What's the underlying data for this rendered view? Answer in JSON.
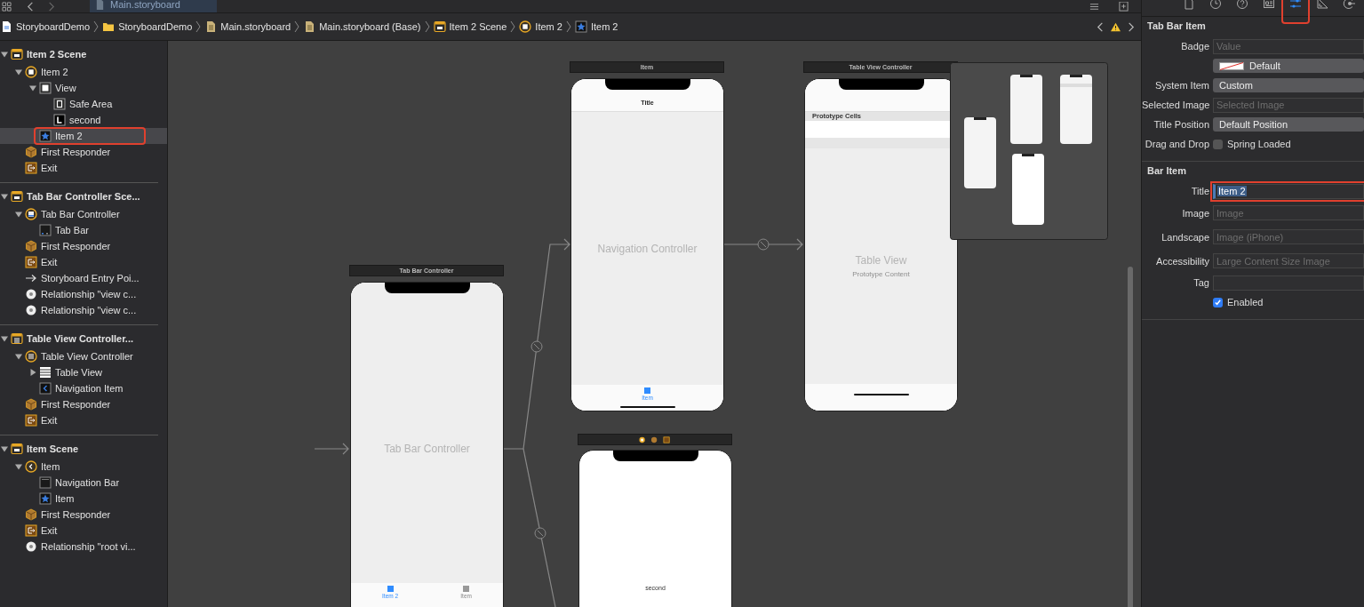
{
  "toolbar": {
    "tab": "Main.storyboard"
  },
  "jump_bar": [
    {
      "kind": "project",
      "text": "StoryboardDemo"
    },
    {
      "kind": "folder",
      "text": "StoryboardDemo"
    },
    {
      "kind": "storyboard",
      "text": "Main.storyboard"
    },
    {
      "kind": "storyboard",
      "text": "Main.storyboard (Base)"
    },
    {
      "kind": "scene",
      "text": "Item 2 Scene"
    },
    {
      "kind": "controller",
      "text": "Item 2"
    },
    {
      "kind": "star",
      "text": "Item 2"
    }
  ],
  "outline": [
    {
      "label": "Item 2 Scene",
      "kind": "scene",
      "expanded": true,
      "selected": false,
      "children": [
        {
          "label": "Item 2",
          "kind": "controller",
          "expanded": true,
          "selected": false,
          "children": [
            {
              "label": "View",
              "kind": "view",
              "expanded": true,
              "selected": false,
              "children": [
                {
                  "label": "Safe Area",
                  "kind": "safe-area",
                  "selected": false
                },
                {
                  "label": "second",
                  "kind": "label",
                  "selected": false
                }
              ]
            },
            {
              "label": "Item 2",
              "kind": "star",
              "selected": true
            }
          ]
        },
        {
          "label": "First Responder",
          "kind": "cube",
          "selected": false
        },
        {
          "label": "Exit",
          "kind": "exit",
          "selected": false
        }
      ]
    },
    {
      "label": "Tab Bar Controller Sce...",
      "kind": "scene",
      "expanded": true,
      "selected": false,
      "children": [
        {
          "label": "Tab Bar Controller",
          "kind": "tab-controller",
          "expanded": true,
          "selected": false,
          "children": [
            {
              "label": "Tab Bar",
              "kind": "tab-bar",
              "selected": false
            }
          ]
        },
        {
          "label": "First Responder",
          "kind": "cube",
          "selected": false
        },
        {
          "label": "Exit",
          "kind": "exit",
          "selected": false
        },
        {
          "label": "Storyboard Entry Poi...",
          "kind": "arrow",
          "selected": false
        },
        {
          "label": "Relationship \"view c...",
          "kind": "ring",
          "selected": false
        },
        {
          "label": "Relationship \"view c...",
          "kind": "ring",
          "selected": false
        }
      ]
    },
    {
      "label": "Table View Controller...",
      "kind": "scene-list",
      "expanded": true,
      "selected": false,
      "children": [
        {
          "label": "Table View Controller",
          "kind": "table-controller",
          "expanded": true,
          "selected": false,
          "children": [
            {
              "label": "Table View",
              "kind": "table",
              "expanded": false,
              "selected": false
            },
            {
              "label": "Navigation Item",
              "kind": "nav-item",
              "selected": false
            }
          ]
        },
        {
          "label": "First Responder",
          "kind": "cube",
          "selected": false
        },
        {
          "label": "Exit",
          "kind": "exit",
          "selected": false
        }
      ]
    },
    {
      "label": "Item Scene",
      "kind": "scene-tag",
      "expanded": true,
      "selected": false,
      "children": [
        {
          "label": "Item",
          "kind": "nav-controller",
          "expanded": true,
          "selected": false,
          "children": [
            {
              "label": "Navigation Bar",
              "kind": "nav-bar",
              "selected": false
            },
            {
              "label": "Item",
              "kind": "star",
              "selected": false
            }
          ]
        },
        {
          "label": "First Responder",
          "kind": "cube",
          "selected": false
        },
        {
          "label": "Exit",
          "kind": "exit",
          "selected": false
        },
        {
          "label": "Relationship \"root vi...",
          "kind": "ring",
          "selected": false
        }
      ]
    }
  ],
  "canvas": {
    "scenes": [
      {
        "kind": "tab-bar",
        "title": "Tab Bar Controller",
        "label": "Tab Bar Controller",
        "tab_items": [
          {
            "label": "Item 2",
            "selected": true
          },
          {
            "label": "Item",
            "selected": false
          }
        ]
      },
      {
        "kind": "navigation",
        "title": "Item",
        "nav_title": "Title",
        "label": "Navigation Controller",
        "tab_items": [
          {
            "label": "Item",
            "selected": true
          }
        ]
      },
      {
        "kind": "table",
        "title": "Table View Controller",
        "section_header": "Prototype Cells",
        "label": "Table View",
        "sublabel": "Prototype Content"
      },
      {
        "kind": "view",
        "label": "second"
      }
    ]
  },
  "inspector": {
    "tabs": [
      {
        "kind": "file",
        "selected": false
      },
      {
        "kind": "history",
        "selected": false
      },
      {
        "kind": "help",
        "selected": false
      },
      {
        "kind": "identity",
        "selected": false
      },
      {
        "kind": "attributes",
        "selected": true
      },
      {
        "kind": "size",
        "selected": false
      },
      {
        "kind": "connections",
        "selected": false
      }
    ],
    "sections": [
      {
        "title": "Tab Bar Item",
        "rows": [
          {
            "kind": "text",
            "label": "Badge",
            "placeholder": "Value",
            "highlighted": false
          },
          {
            "kind": "color",
            "value": "Default",
            "highlighted": false
          },
          {
            "kind": "popup",
            "label": "System Item",
            "value": "Custom",
            "highlighted": false
          },
          {
            "kind": "text",
            "label": "Selected Image",
            "placeholder": "Selected Image",
            "highlighted": false
          },
          {
            "kind": "popup",
            "label": "Title Position",
            "value": "Default Position",
            "highlighted": false
          },
          {
            "kind": "checkbox",
            "label": "Drag and Drop",
            "text": "Spring Loaded",
            "checked": false,
            "highlighted": false
          }
        ]
      },
      {
        "title": "Bar Item",
        "rows": [
          {
            "kind": "text",
            "label": "Title",
            "value": "Item 2",
            "highlighted": true
          },
          {
            "kind": "text",
            "label": "Image",
            "placeholder": "Image",
            "highlighted": false
          },
          {
            "kind": "text",
            "label": "Landscape",
            "placeholder": "Image (iPhone)",
            "highlighted": false
          },
          {
            "kind": "text",
            "label": "Accessibility",
            "placeholder": "Large Content Size Image",
            "highlighted": false
          },
          {
            "kind": "text",
            "label": "Tag",
            "highlighted": false
          },
          {
            "kind": "checkbox",
            "text": "Enabled",
            "checked": true,
            "highlighted": false
          }
        ]
      }
    ]
  }
}
